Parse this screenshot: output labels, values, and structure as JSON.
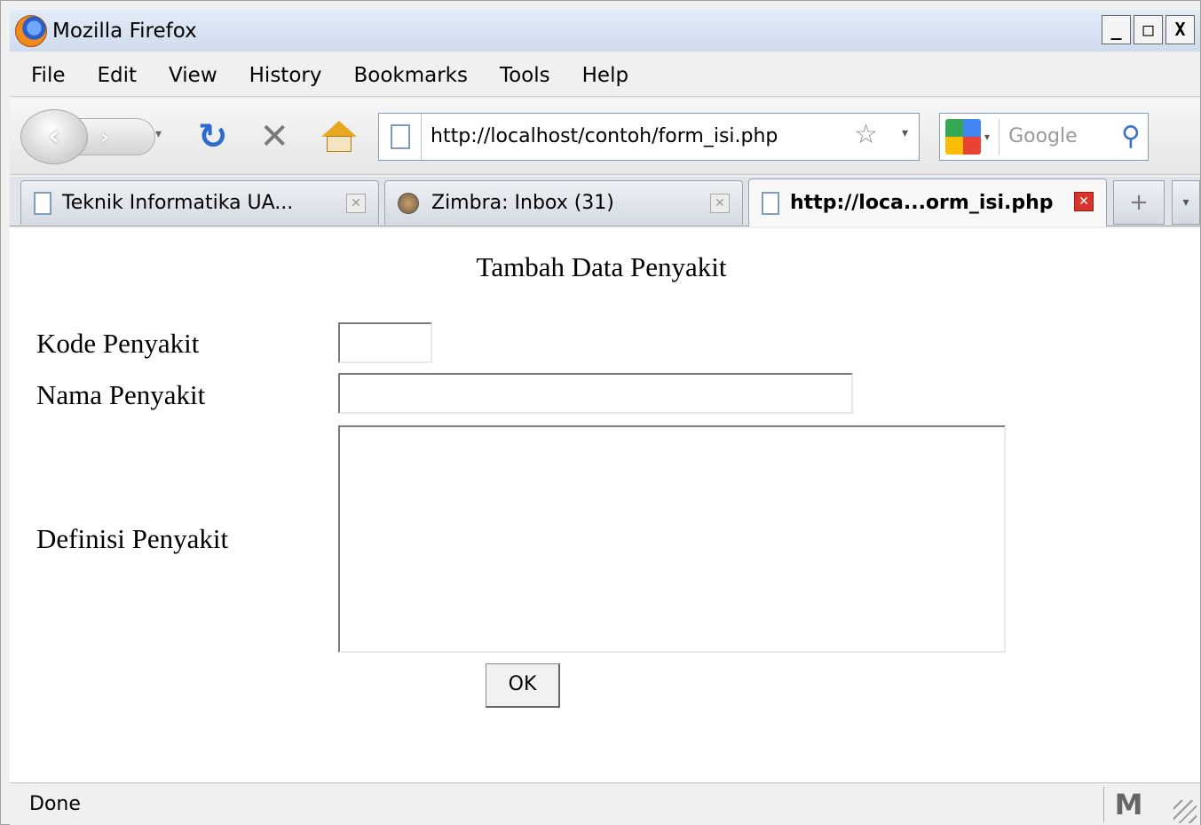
{
  "window": {
    "title": "Mozilla Firefox",
    "controls": [
      "_",
      "□",
      "X"
    ]
  },
  "menu": [
    "File",
    "Edit",
    "View",
    "History",
    "Bookmarks",
    "Tools",
    "Help"
  ],
  "nav": {
    "url": "http://localhost/contoh/form_isi.php",
    "search_placeholder": "Google"
  },
  "tabs": [
    {
      "label": "Teknik Informatika UA..."
    },
    {
      "label": "Zimbra: Inbox (31)"
    },
    {
      "label": "http://loca...orm_isi.php"
    }
  ],
  "tab_new": "+",
  "page": {
    "heading": "Tambah Data Penyakit",
    "labels": {
      "kode": "Kode Penyakit",
      "nama": "Nama Penyakit",
      "definisi": "Definisi Penyakit"
    },
    "values": {
      "kode": "",
      "nama": "",
      "definisi": ""
    },
    "ok_label": "OK"
  },
  "status": {
    "text": "Done"
  }
}
